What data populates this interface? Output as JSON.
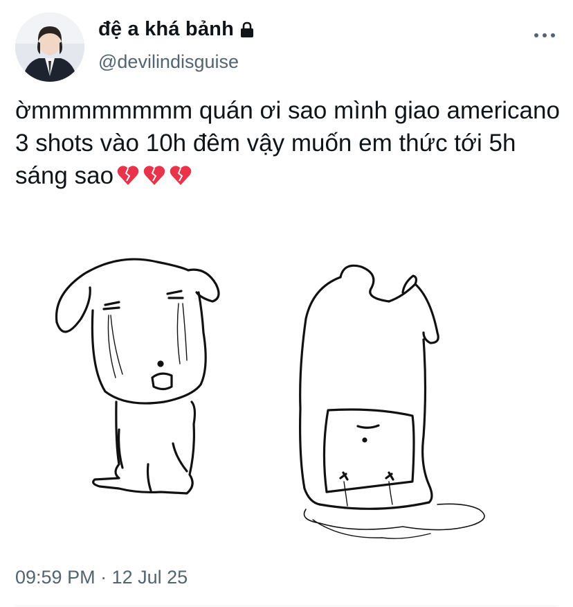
{
  "user": {
    "display_name": "đệ a khá bảnh",
    "handle": "@devilindisguise",
    "avatar_icon": "profile-photo",
    "lock_icon": "lock-icon"
  },
  "tweet": {
    "text": "ờmmmmmmmm quán ơi sao mình giao americano 3 shots vào 10h đêm vậy muốn em thức tới 5h sáng sao",
    "emoji": [
      "💔",
      "💔",
      "💔"
    ],
    "timestamp": "09:59 PM · 12 Jul 25"
  },
  "more_icon": "more-horizontal-icon",
  "colors": {
    "text": "#0f1419",
    "secondary": "#536471",
    "heart": "#e8334a"
  }
}
